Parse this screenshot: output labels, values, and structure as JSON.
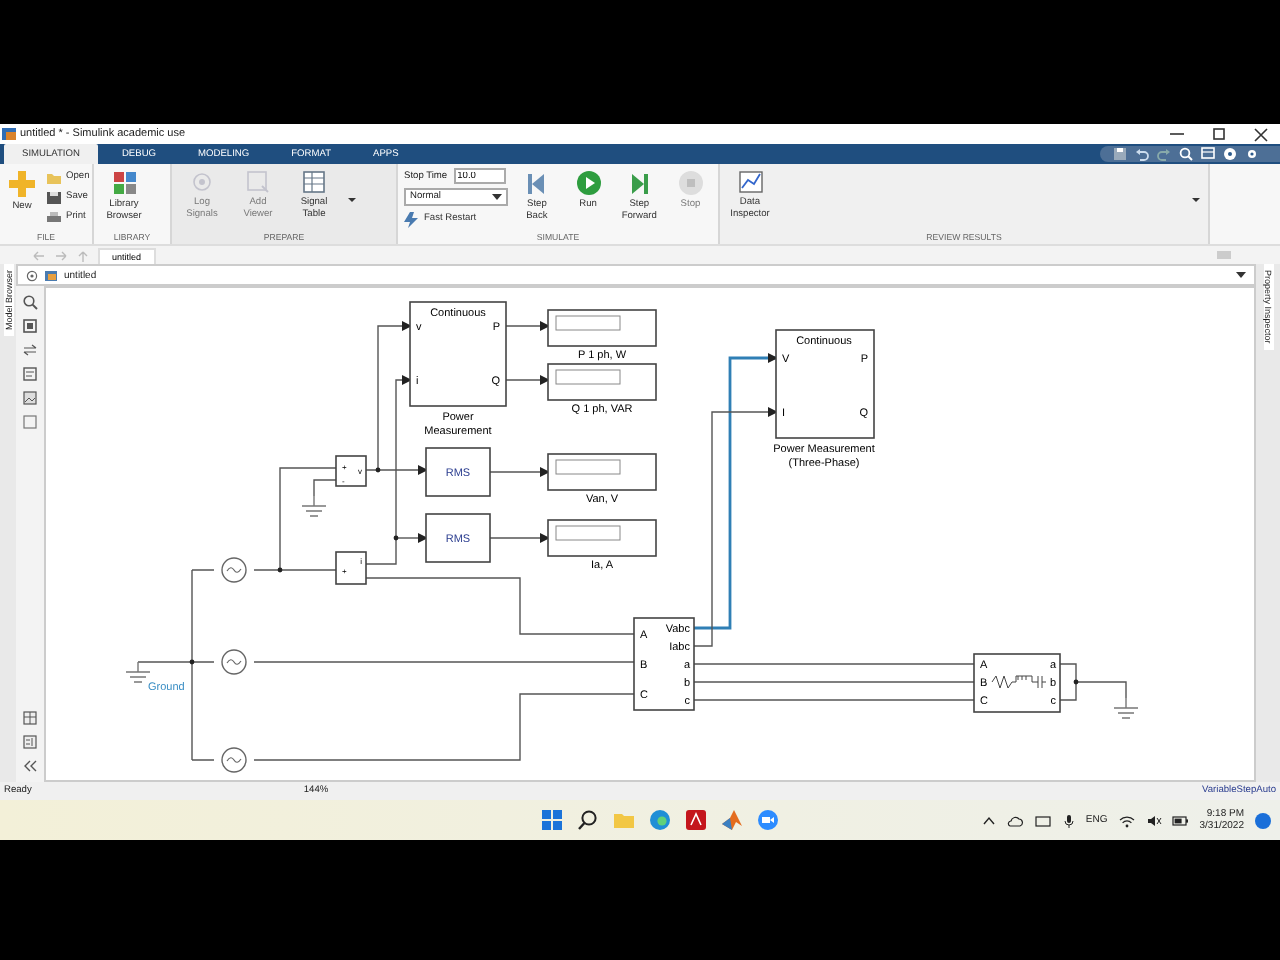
{
  "window": {
    "title": "untitled * - Simulink academic use"
  },
  "tabs": [
    {
      "label": "SIMULATION",
      "selected": true
    },
    {
      "label": "DEBUG",
      "selected": false
    },
    {
      "label": "MODELING",
      "selected": false
    },
    {
      "label": "FORMAT",
      "selected": false
    },
    {
      "label": "APPS",
      "selected": false
    }
  ],
  "toolstrip": {
    "file": {
      "label": "FILE",
      "new": "New",
      "open": "Open",
      "save": "Save",
      "print": "Print"
    },
    "library": {
      "label": "LIBRARY",
      "browser": "Library Browser"
    },
    "prepare": {
      "label": "PREPARE",
      "buttons": [
        {
          "label": "Log Signals",
          "disabled": true
        },
        {
          "label": "Add Viewer",
          "disabled": true
        },
        {
          "label": "Signal Table",
          "disabled": false
        }
      ]
    },
    "simulate": {
      "label": "SIMULATE",
      "stop_time_label": "Stop Time",
      "stop_time": "10.0",
      "mode": "Normal",
      "fast_restart": "Fast Restart",
      "step_back": "Step Back",
      "run": "Run",
      "step_forward": "Step Forward",
      "stop": {
        "label": "Stop",
        "disabled": true
      }
    },
    "review": {
      "label": "REVIEW RESULTS",
      "data_inspector": "Data Inspector"
    }
  },
  "breadcrumb_tab": "untitled",
  "address": "untitled",
  "left_panel": "Model Browser",
  "right_panel": "Property Inspector",
  "diagram": {
    "power_1ph": {
      "header": "Continuous",
      "inputs": [
        "v",
        "i"
      ],
      "outputs": [
        "P",
        "Q"
      ],
      "caption": [
        "Power",
        "Measurement"
      ]
    },
    "displays": [
      {
        "caption": "P 1 ph, W"
      },
      {
        "caption": "Q 1 ph, VAR"
      },
      {
        "caption": "Van, V"
      },
      {
        "caption": "Ia, A"
      }
    ],
    "rms_blocks": [
      {
        "label": "RMS"
      },
      {
        "label": "RMS"
      }
    ],
    "voltage_meas": {
      "inputs": [
        "+",
        "-"
      ],
      "output": "v"
    },
    "current_meas": {
      "input": "+",
      "output": "i"
    },
    "power_3ph": {
      "header": "Continuous",
      "inputs": [
        "V",
        "I"
      ],
      "outputs": [
        "P",
        "Q"
      ],
      "caption": [
        "Power Measurement",
        "(Three-Phase)"
      ]
    },
    "vi_meas": {
      "inputs": [
        "A",
        "B",
        "C"
      ],
      "outputs": [
        "Vabc",
        "Iabc",
        "a",
        "b",
        "c"
      ]
    },
    "rlc_load": {
      "inputs": [
        "A",
        "B",
        "C"
      ],
      "outputs": [
        "a",
        "b",
        "c"
      ]
    },
    "ground_label": "Ground"
  },
  "status_bar": {
    "left": "Ready",
    "zoom": "144%",
    "solver": "VariableStepAuto"
  },
  "taskbar": {
    "language": "ENG",
    "time": "9:18 PM",
    "date": "3/31/2022"
  }
}
